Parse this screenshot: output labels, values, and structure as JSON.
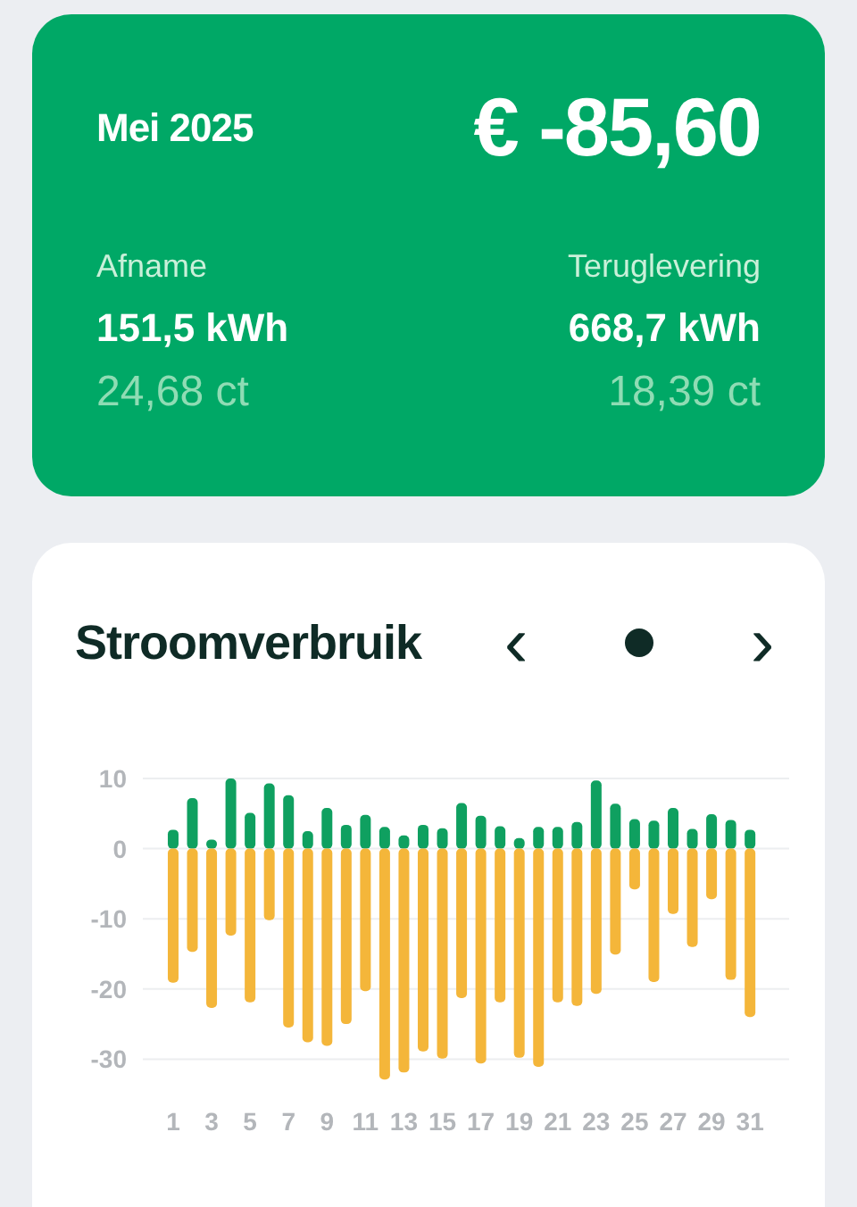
{
  "summary": {
    "period": "Mei 2025",
    "total": "€ -85,60",
    "afname": {
      "label": "Afname",
      "energy": "151,5 kWh",
      "price": "24,68 ct"
    },
    "teruglevering": {
      "label": "Teruglevering",
      "energy": "668,7 kWh",
      "price": "18,39 ct"
    }
  },
  "usage": {
    "title": "Stroomverbruik",
    "nav": {
      "previous": "‹",
      "next": "›"
    },
    "chart_data": {
      "type": "bar",
      "stacked": true,
      "grid": true,
      "x": [
        1,
        2,
        3,
        4,
        5,
        6,
        7,
        8,
        9,
        10,
        11,
        12,
        13,
        14,
        15,
        16,
        17,
        18,
        19,
        20,
        21,
        22,
        23,
        24,
        25,
        26,
        27,
        28,
        29,
        30,
        31
      ],
      "xlim": [
        0.5,
        31.5
      ],
      "xticks": [
        1,
        3,
        5,
        7,
        9,
        11,
        13,
        15,
        17,
        19,
        21,
        23,
        25,
        27,
        29,
        31
      ],
      "ylim": [
        -33,
        10
      ],
      "yticks": [
        10,
        0,
        -10,
        -20,
        -30
      ],
      "series": [
        {
          "color": "#0fa060",
          "values": [
            2.7,
            7.2,
            1.3,
            10.0,
            5.1,
            9.3,
            7.6,
            2.5,
            5.8,
            3.4,
            4.8,
            3.1,
            1.9,
            3.4,
            2.9,
            6.5,
            4.7,
            3.2,
            1.5,
            3.1,
            3.1,
            3.8,
            9.7,
            6.4,
            4.2,
            4.0,
            5.8,
            2.8,
            4.9,
            4.1,
            2.7
          ]
        },
        {
          "color": "#f4b63a",
          "values": [
            -19.1,
            -14.7,
            -22.7,
            -12.4,
            -21.9,
            -10.2,
            -25.5,
            -27.6,
            -28.1,
            -25.0,
            -20.3,
            -32.9,
            -31.9,
            -28.9,
            -29.9,
            -21.3,
            -30.6,
            -21.9,
            -29.8,
            -31.1,
            -21.9,
            -22.4,
            -20.7,
            -15.1,
            -5.8,
            -19.0,
            -9.3,
            -14.0,
            -7.2,
            -18.7,
            -24.0
          ]
        }
      ]
    }
  }
}
